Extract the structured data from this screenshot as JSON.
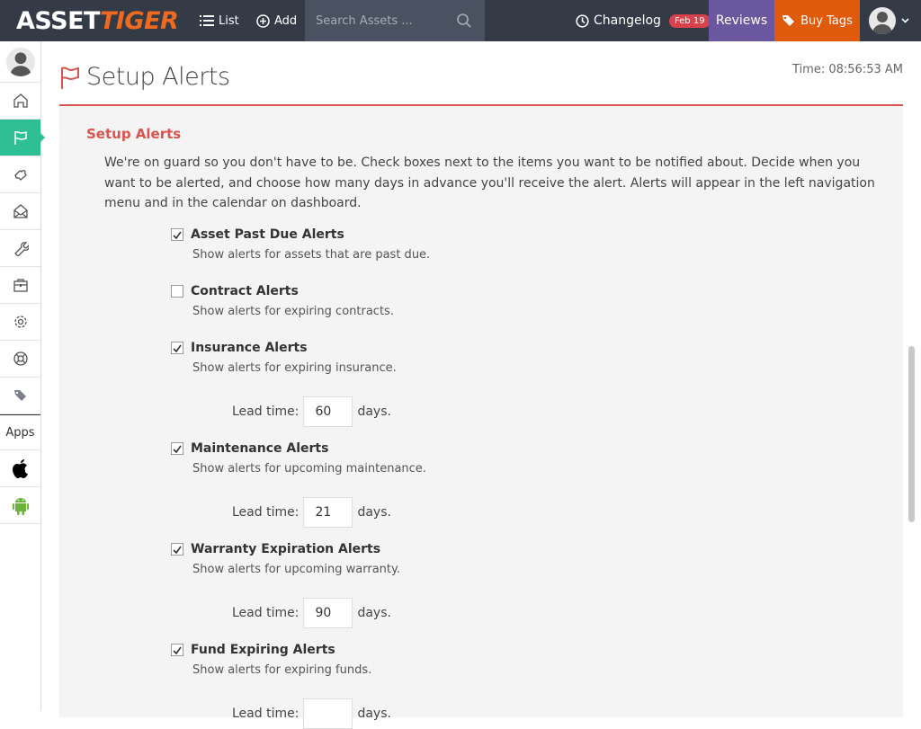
{
  "topbar": {
    "logo_part1": "ASSET",
    "logo_part2": "TIGER",
    "list_label": "List",
    "add_label": "Add",
    "search_placeholder": "Search Assets ...",
    "changelog_label": "Changelog",
    "changelog_badge": "Feb 19",
    "reviews_label": "Reviews",
    "buytags_label": "Buy Tags"
  },
  "sidebar": {
    "items": [
      {
        "name": "home"
      },
      {
        "name": "alerts",
        "active": true
      },
      {
        "name": "tools"
      },
      {
        "name": "inbox"
      },
      {
        "name": "maintenance"
      },
      {
        "name": "briefcase"
      },
      {
        "name": "settings"
      },
      {
        "name": "help"
      },
      {
        "name": "tags"
      }
    ],
    "apps_label": "Apps"
  },
  "page": {
    "title": "Setup Alerts",
    "time": "Time: 08:56:53 AM",
    "section_title": "Setup Alerts",
    "intro": "We're on guard so you don't have to be. Check boxes next to the items you want to be notified about. Decide when you want to be alerted, and choose how many days in advance you'll receive the alert. Alerts will appear in the left navigation menu and in the calendar on dashboard.",
    "lead_label": "Lead time:",
    "days_label": "days.",
    "alerts": [
      {
        "label": "Asset Past Due Alerts",
        "desc": "Show alerts for assets that are past due.",
        "checked": true
      },
      {
        "label": "Contract Alerts",
        "desc": "Show alerts for expiring contracts.",
        "checked": false
      },
      {
        "label": "Insurance Alerts",
        "desc": "Show alerts for expiring insurance.",
        "checked": true,
        "lead": "60"
      },
      {
        "label": "Maintenance Alerts",
        "desc": "Show alerts for upcoming maintenance.",
        "checked": true,
        "lead": "21"
      },
      {
        "label": "Warranty Expiration Alerts",
        "desc": "Show alerts for upcoming warranty.",
        "checked": true,
        "lead": "90"
      },
      {
        "label": "Fund Expiring Alerts",
        "desc": "Show alerts for expiring funds.",
        "checked": true
      }
    ]
  },
  "colors": {
    "topbar": "#343a46",
    "accent_green": "#2ebf96",
    "accent_red": "#d9534f",
    "reviews": "#6a57a0",
    "buytags": "#e05a0b"
  }
}
